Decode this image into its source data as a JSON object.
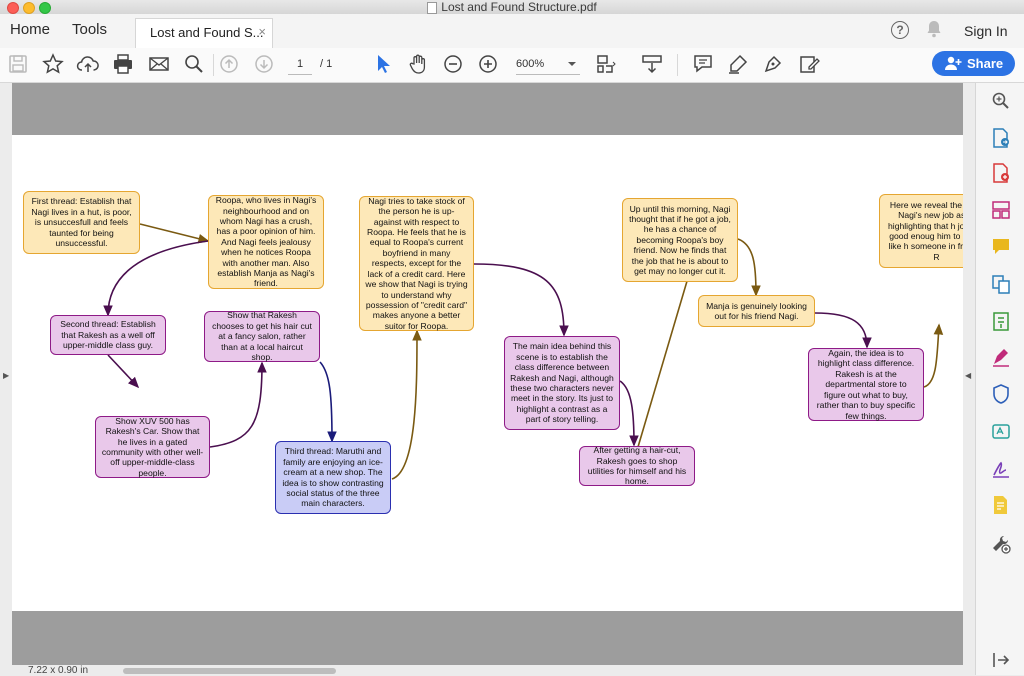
{
  "window": {
    "title": "Lost and Found Structure.pdf"
  },
  "tabs": {
    "home": "Home",
    "tools": "Tools",
    "doc": "Lost and Found S...",
    "close": "×"
  },
  "header": {
    "sign_in": "Sign In",
    "help": "?"
  },
  "toolbar": {
    "page_current": "1",
    "page_total": "/ 1",
    "zoom": "600%",
    "share": "Share"
  },
  "status": {
    "dimensions": "7.22 x 0.90 in"
  },
  "colors": {
    "accent": "#2c73e4",
    "orange_fill": "#fde8b8",
    "orange_border": "#e5a631",
    "purple_fill": "#e9c8ea",
    "purple_border": "#8e1a87",
    "blue_fill": "#c9ccf6",
    "blue_border": "#2a2fb0"
  },
  "icons": [
    "save-icon",
    "star-icon",
    "upload-icon",
    "print-icon",
    "mail-icon",
    "search-zoom-icon",
    "prev-page-icon",
    "next-page-icon",
    "select-cursor-icon",
    "hand-icon",
    "zoom-out-icon",
    "zoom-in-icon",
    "page-fit-icon",
    "scroll-mode-icon",
    "comment-icon",
    "highlight-icon",
    "sign-icon",
    "edit-icon",
    "bell-icon",
    "search-sidebar-icon",
    "export-pdf-icon",
    "create-pdf-icon",
    "organize-pages-icon",
    "comment-sidebar-icon",
    "combine-icon",
    "compress-icon",
    "fill-sign-icon",
    "protect-icon",
    "edit-pdf-icon",
    "request-sign-icon",
    "send-review-icon",
    "more-tools-icon",
    "expand-panel-icon"
  ],
  "nodes": [
    {
      "id": "n1",
      "text": "First thread: Establish that Nagi lives in a hut, is poor, is unsuccesfull and feels taunted for being unsuccessful."
    },
    {
      "id": "n2",
      "text": "Roopa, who lives in Nagi's neighbourhood and on whom Nagi has a crush, has a poor opinion of him. And Nagi feels jealousy when he notices Roopa with another man. Also establish Manja as Nagi's friend."
    },
    {
      "id": "n3",
      "text": "Second thread: Establish that Rakesh as a well off upper-middle class guy."
    },
    {
      "id": "n4",
      "text": "Show XUV 500 has Rakesh's Car. Show that he lives in a gated community with other well-off upper-middle-class people."
    },
    {
      "id": "n5",
      "text": "Show that Rakesh chooses to get his hair cut at a fancy salon, rather than at a local haircut shop."
    },
    {
      "id": "n6",
      "text": "Third thread: Maruthi and family are enjoying an ice-cream at a new shop. The idea is to show contrasting social status of the three main characters."
    },
    {
      "id": "n7",
      "text": "Nagi tries to take stock of the person he is up-against with respect to Roopa. He feels that he is equal to Roopa's current boyfriend in many respects, except for the lack of a credit card. Here we show that Nagi is trying to understand why possession of \"credit card\" makes anyone a better suitor for Roopa."
    },
    {
      "id": "n8",
      "text": "The main idea behind this scene is to establish the class difference between Rakesh and Nagi, although these two characters never meet in the story. Its just to highlight a contrast as a part of story telling."
    },
    {
      "id": "n9",
      "text": "After getting a hair-cut, Rakesh goes to shop utilities for himself and his home."
    },
    {
      "id": "n10",
      "text": "Up until this morning, Nagi thought that if he got a job, he has a chance of becoming Roopa's boy friend. Now he finds that the job that he is about to get may no longer cut it."
    },
    {
      "id": "n11",
      "text": "Manja is genuinely looking out for his friend Nagi."
    },
    {
      "id": "n12",
      "text": "Again, the idea is to highlight class difference. Rakesh is at the departmental store to figure out what to buy, rather than to buy specific few things."
    },
    {
      "id": "n13",
      "text": "Here we reveal the sp of Nagi's new job as of highlighting that h job isnt good enoug him to seem like h someone in front of R"
    }
  ]
}
